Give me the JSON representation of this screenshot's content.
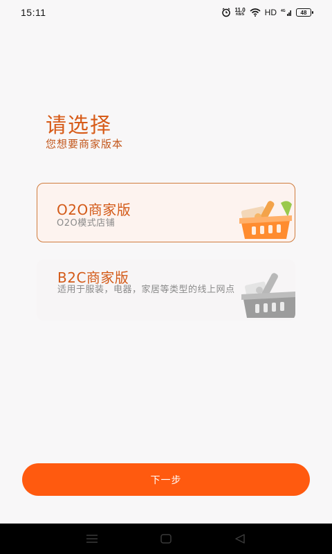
{
  "status_bar": {
    "time": "15:11",
    "net_speed": "11.0",
    "net_unit": "KB/S",
    "hd": "HD",
    "signal": "4G",
    "battery": "48"
  },
  "header": {
    "title": "请选择",
    "subtitle": "您想要商家版本"
  },
  "options": [
    {
      "title": "O2O商家版",
      "description": "O2O模式店铺",
      "selected": true,
      "icon": "shopping-basket-icon"
    },
    {
      "title": "B2C商家版",
      "description": "适用于服装，电器，家居等类型的线上网点",
      "selected": false,
      "icon": "shopping-basket-icon"
    }
  ],
  "actions": {
    "next_label": "下一步"
  },
  "colors": {
    "accent": "#ff5a0f",
    "title": "#d75b18",
    "selected_border": "#cf7b3c",
    "selected_bg": "#fdf3ef"
  }
}
